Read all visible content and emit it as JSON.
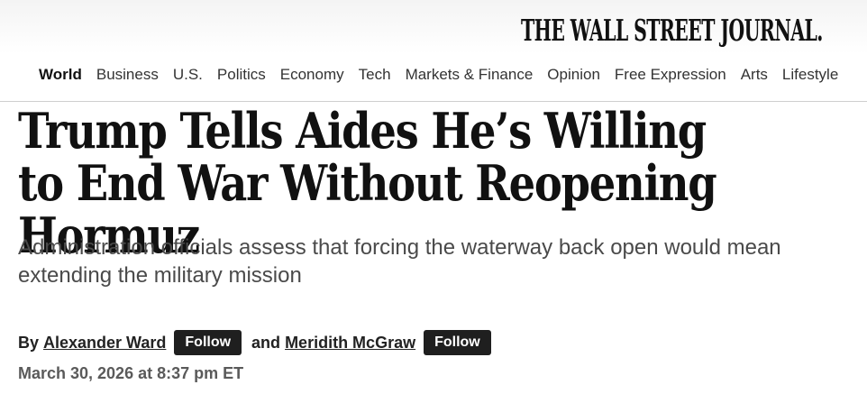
{
  "masthead": {
    "logo_text": "THE WALL STREET JOURNAL."
  },
  "nav": {
    "items": [
      {
        "label": "World",
        "active": true
      },
      {
        "label": "Business"
      },
      {
        "label": "U.S."
      },
      {
        "label": "Politics"
      },
      {
        "label": "Economy"
      },
      {
        "label": "Tech"
      },
      {
        "label": "Markets & Finance"
      },
      {
        "label": "Opinion"
      },
      {
        "label": "Free Expression"
      },
      {
        "label": "Arts"
      },
      {
        "label": "Lifestyle"
      }
    ]
  },
  "article": {
    "headline": "Trump Tells Aides He’s Willing to End War Without Reopening Hormuz",
    "dek": "Administration officials assess that forcing the waterway back open would mean extending the military mission",
    "byline": {
      "prefix": "By",
      "authors": [
        {
          "name": "Alexander Ward",
          "follow_label": "Follow"
        },
        {
          "name": "Meridith McGraw",
          "follow_label": "Follow"
        }
      ],
      "conjunction": "and"
    },
    "timestamp": "March 30, 2026 at 8:37 pm ET"
  }
}
